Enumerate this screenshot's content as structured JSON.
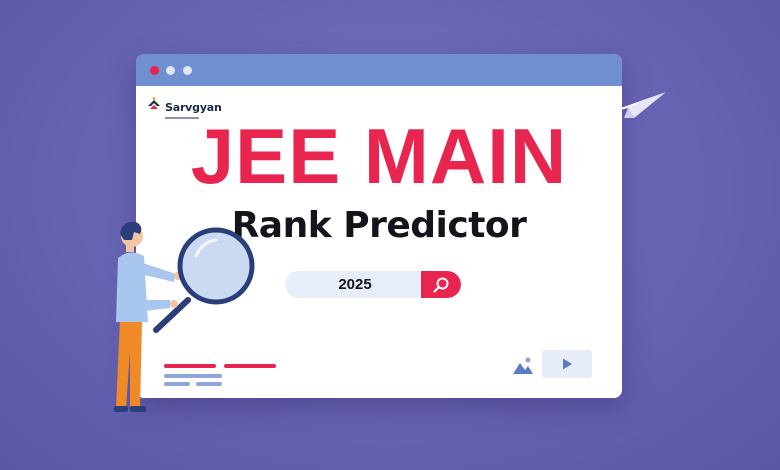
{
  "colors": {
    "background": "#6a66b6",
    "titlebar": "#6f8fd0",
    "accent": "#e8254f",
    "heading_text": "#14141c",
    "search_bg": "#e7edf9"
  },
  "window": {
    "controls": [
      "close-dot",
      "minimize-dot",
      "maximize-dot"
    ]
  },
  "logo": {
    "name": "Sarvgyan",
    "icon": "sarvgyan-logo-icon"
  },
  "hero": {
    "title": "JEE MAIN",
    "subtitle": "Rank Predictor"
  },
  "search": {
    "value": "2025",
    "icon": "search-icon"
  },
  "illustration": {
    "figure": "person-with-magnifier-illustration",
    "decoration": "paper-plane-icon",
    "media_icons": [
      "image-icon",
      "play-icon"
    ]
  }
}
